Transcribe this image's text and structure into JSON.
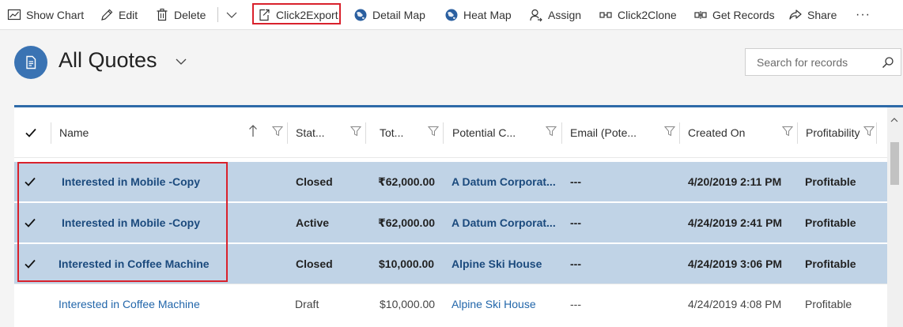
{
  "commands": [
    {
      "label": "Show Chart",
      "icon": "chart-icon"
    },
    {
      "label": "Edit",
      "icon": "pencil-icon"
    },
    {
      "label": "Delete",
      "icon": "trash-icon"
    },
    {
      "label": "Click2Export",
      "icon": "export-icon"
    },
    {
      "label": "Detail Map",
      "icon": "globe-icon"
    },
    {
      "label": "Heat Map",
      "icon": "globe-icon"
    },
    {
      "label": "Assign",
      "icon": "person-icon"
    },
    {
      "label": "Click2Clone",
      "icon": "clone-icon"
    },
    {
      "label": "Get Records",
      "icon": "records-icon"
    },
    {
      "label": "Share",
      "icon": "share-icon"
    },
    {
      "label": "···",
      "icon": "more-icon"
    }
  ],
  "header": {
    "title": "All Quotes",
    "search_placeholder": "Search for records"
  },
  "grid": {
    "columns": [
      {
        "label": "Name"
      },
      {
        "label": "Stat..."
      },
      {
        "label": "Tot..."
      },
      {
        "label": "Potential C..."
      },
      {
        "label": "Email (Pote..."
      },
      {
        "label": "Created On"
      },
      {
        "label": "Profitability"
      }
    ],
    "rows": [
      {
        "selected": true,
        "name": "Interested in Mobile -Copy",
        "status": "Closed",
        "total": "₹62,000.00",
        "customer": "A Datum Corporat...",
        "email": "---",
        "created": "4/20/2019 2:11 PM",
        "profitability": "Profitable"
      },
      {
        "selected": true,
        "name": "Interested in Mobile -Copy",
        "status": "Active",
        "total": "₹62,000.00",
        "customer": "A Datum Corporat...",
        "email": "---",
        "created": "4/24/2019 2:41 PM",
        "profitability": "Profitable"
      },
      {
        "selected": true,
        "name": "Interested in Coffee Machine",
        "status": "Closed",
        "total": "$10,000.00",
        "customer": "Alpine Ski House",
        "email": "---",
        "created": "4/24/2019 3:06 PM",
        "profitability": "Profitable"
      },
      {
        "selected": false,
        "name": "Interested in Coffee Machine",
        "status": "Draft",
        "total": "$10,000.00",
        "customer": "Alpine Ski House",
        "email": "---",
        "created": "4/24/2019 4:08 PM",
        "profitability": "Profitable"
      }
    ]
  },
  "colors": {
    "accent": "#2e6aa8",
    "selected_row": "#c0d3e6",
    "highlight": "#d9212c",
    "link": "#1f5f9f",
    "view_icon": "#3a73b3"
  }
}
